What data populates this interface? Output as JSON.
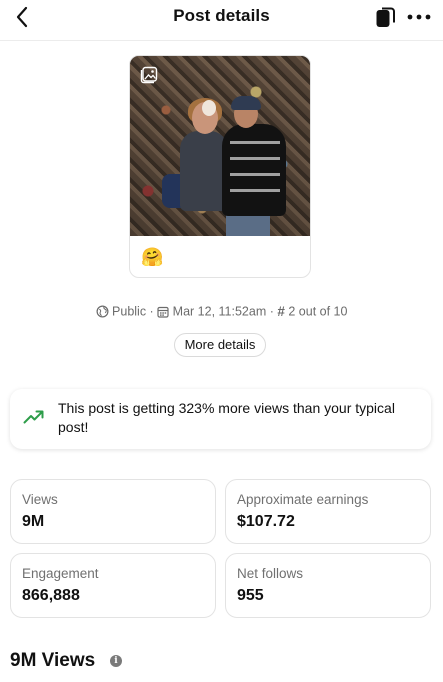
{
  "header": {
    "title": "Post details",
    "back_icon": "chevron-left-icon",
    "switch_icon": "copy-switch-icon",
    "more_icon": "more-horizontal-icon"
  },
  "post": {
    "caption_emoji": "🤗",
    "media_icon": "gallery-icon"
  },
  "meta": {
    "visibility": "Public",
    "date": "Mar 12, 11:52am",
    "rank": "2 out of 10",
    "separator": " · ",
    "hash": "#"
  },
  "more_details_label": "More details",
  "insight": {
    "text": "This post is getting 323% more views than your typical post!",
    "icon": "trending-up-icon",
    "accent": "#2e9d4a"
  },
  "stats": [
    {
      "label": "Views",
      "value": "9M"
    },
    {
      "label": "Approximate earnings",
      "value": "$107.72"
    },
    {
      "label": "Engagement",
      "value": "866,888"
    },
    {
      "label": "Net follows",
      "value": "955"
    }
  ],
  "section": {
    "heading": "9M Views",
    "info_glyph": "i"
  }
}
